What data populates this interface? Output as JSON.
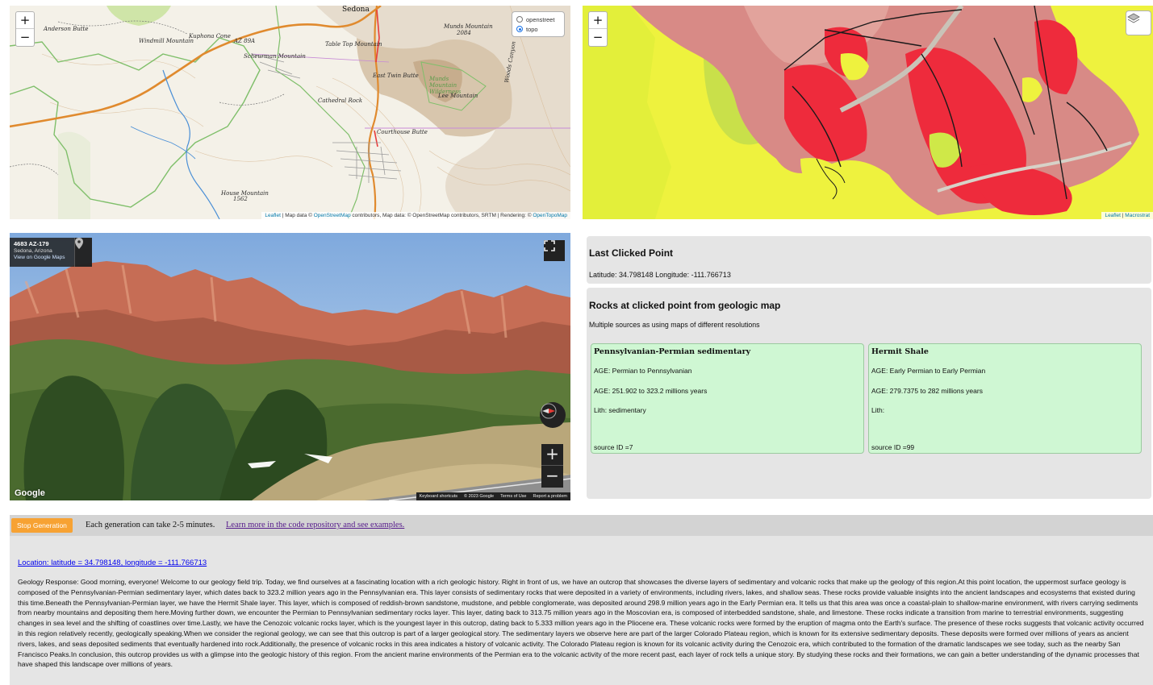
{
  "topo_map": {
    "zoom_in": "+",
    "zoom_out": "−",
    "layers": [
      {
        "label": "openstreet",
        "selected": false
      },
      {
        "label": "topo",
        "selected": true
      }
    ],
    "labels": {
      "sedona": "Sedona",
      "anderson_butte": "Anderson Butte",
      "windmill_mountain": "Windmill Mountain",
      "kuphona_cone": "Kuphona Cone",
      "az89a": "AZ 89A",
      "table_top": "Table Top Mountain",
      "scheurman": "Scheurman Mountain",
      "munds_mountain": "Munds Mountain",
      "munds_elev": "2084",
      "east_twin_butte": "East Twin Butte",
      "munds_wilderness": "Munds Mountain Wilderness",
      "lee_mountain": "Lee Mountain",
      "cathedral_rock": "Cathedral Rock",
      "courthouse_butte": "Courthouse Butte",
      "house_mountain": "House Mountain",
      "house_elev": "1562",
      "woods_canyon": "Woods Canyon"
    },
    "attribution": {
      "leaflet": "Leaflet",
      "text1": " | Map data © ",
      "osm": "OpenStreetMap",
      "text2": " contributors, Map data: © OpenStreetMap contributors, SRTM | Rendering: © ",
      "opentopo": "OpenTopoMap"
    }
  },
  "geo_map": {
    "zoom_in": "+",
    "zoom_out": "−",
    "layers_icon": "layers-icon",
    "attribution": {
      "leaflet": "Leaflet",
      "sep": " | ",
      "macrostrat": "Macrostrat"
    },
    "colors": {
      "base": "#eef23e",
      "brown": "#d08080",
      "red": "#ee2b3c",
      "lime": "#cfe848"
    }
  },
  "street_view": {
    "title": "4683 AZ-179",
    "subtitle": "Sedona, Arizona",
    "link": "View on Google Maps",
    "zoom_in": "+",
    "zoom_out": "−",
    "logo": "Google",
    "footer": [
      "Keyboard shortcuts",
      "© 2023 Google",
      "Terms of Use",
      "Report a problem"
    ]
  },
  "last_clicked": {
    "heading": "Last Clicked Point",
    "coords": "Latitude: 34.798148 Longitude: -111.766713"
  },
  "rocks": {
    "heading": "Rocks at clicked point from geologic map",
    "subtitle": "Multiple sources as using maps of different resolutions",
    "cards": [
      {
        "name": "Pennsylvanian-Permian sedimentary",
        "age_names": "AGE: Permian to Pennsylvanian",
        "age_years": "AGE: 251.902 to 323.2 millions years",
        "lith": "Lith: sedimentary",
        "source": "source ID =7"
      },
      {
        "name": "Hermit Shale",
        "age_names": "AGE: Early Permian to Early Permian",
        "age_years": "AGE: 279.7375 to 282 millions years",
        "lith": "Lith:",
        "source": "source ID =99"
      }
    ]
  },
  "toolbar": {
    "stop_label": "Stop Generation",
    "note": "Each generation can take 2-5 minutes.",
    "learn_link": "Learn more in the code repository and see examples."
  },
  "response": {
    "location_link": "Location: latitude = 34.798148, longitude = -111.766713",
    "text": "Geology Response: Good morning, everyone! Welcome to our geology field trip. Today, we find ourselves at a fascinating location with a rich geologic history. Right in front of us, we have an outcrop that showcases the diverse layers of sedimentary and volcanic rocks that make up the geology of this region.At this point location, the uppermost surface geology is composed of the Pennsylvanian-Permian sedimentary layer, which dates back to 323.2 million years ago in the Pennsylvanian era. This layer consists of sedimentary rocks that were deposited in a variety of environments, including rivers, lakes, and shallow seas. These rocks provide valuable insights into the ancient landscapes and ecosystems that existed during this time.Beneath the Pennsylvanian-Permian layer, we have the Hermit Shale layer. This layer, which is composed of reddish-brown sandstone, mudstone, and pebble conglomerate, was deposited around 298.9 million years ago in the Early Permian era. It tells us that this area was once a coastal-plain to shallow-marine environment, with rivers carrying sediments from nearby mountains and depositing them here.Moving further down, we encounter the Permian to Pennsylvanian sedimentary rocks layer. This layer, dating back to 313.75 million years ago in the Moscovian era, is composed of interbedded sandstone, shale, and limestone. These rocks indicate a transition from marine to terrestrial environments, suggesting changes in sea level and the shifting of coastlines over time.Lastly, we have the Cenozoic volcanic rocks layer, which is the youngest layer in this outcrop, dating back to 5.333 million years ago in the Pliocene era. These volcanic rocks were formed by the eruption of magma onto the Earth's surface. The presence of these rocks suggests that volcanic activity occurred in this region relatively recently, geologically speaking.When we consider the regional geology, we can see that this outcrop is part of a larger geological story. The sedimentary layers we observe here are part of the larger Colorado Plateau region, which is known for its extensive sedimentary deposits. These deposits were formed over millions of years as ancient rivers, lakes, and seas deposited sediments that eventually hardened into rock.Additionally, the presence of volcanic rocks in this area indicates a history of volcanic activity. The Colorado Plateau region is known for its volcanic activity during the Cenozoic era, which contributed to the formation of the dramatic landscapes we see today, such as the nearby San Francisco Peaks.In conclusion, this outcrop provides us with a glimpse into the geologic history of this region. From the ancient marine environments of the Permian era to the volcanic activity of the more recent past, each layer of rock tells a unique story. By studying these rocks and their formations, we can gain a better understanding of the dynamic processes that have shaped this landscape over millions of years."
  }
}
